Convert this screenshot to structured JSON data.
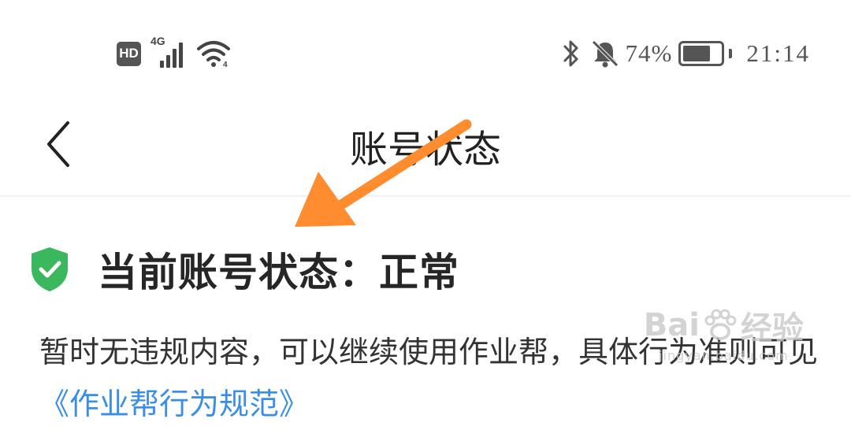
{
  "status_bar": {
    "hd_badge": "HD",
    "network_type": "4G",
    "battery_percent": "74%",
    "time": "21:14",
    "icons": [
      "hd-icon",
      "signal-icon",
      "wifi-icon",
      "bluetooth-icon",
      "bell-muted-icon",
      "battery-icon"
    ],
    "battery_level": 0.74
  },
  "nav": {
    "title": "账号状态",
    "back_icon": "chevron-left-icon"
  },
  "account": {
    "status_heading": "当前账号状态：正常",
    "status_icon": "shield-check-icon",
    "status_color": "#3bb85e",
    "description_text": "暂时无违规内容，可以继续使用作业帮，具体行为准则可见",
    "description_link": "《作业帮行为规范》",
    "link_color": "#3a8ee6"
  },
  "overlay": {
    "annotation_arrow_color": "#ff8c2e",
    "watermark_brand": "Bai",
    "watermark_site_name": "经验",
    "watermark_url": "jingyan.baidu.com"
  }
}
